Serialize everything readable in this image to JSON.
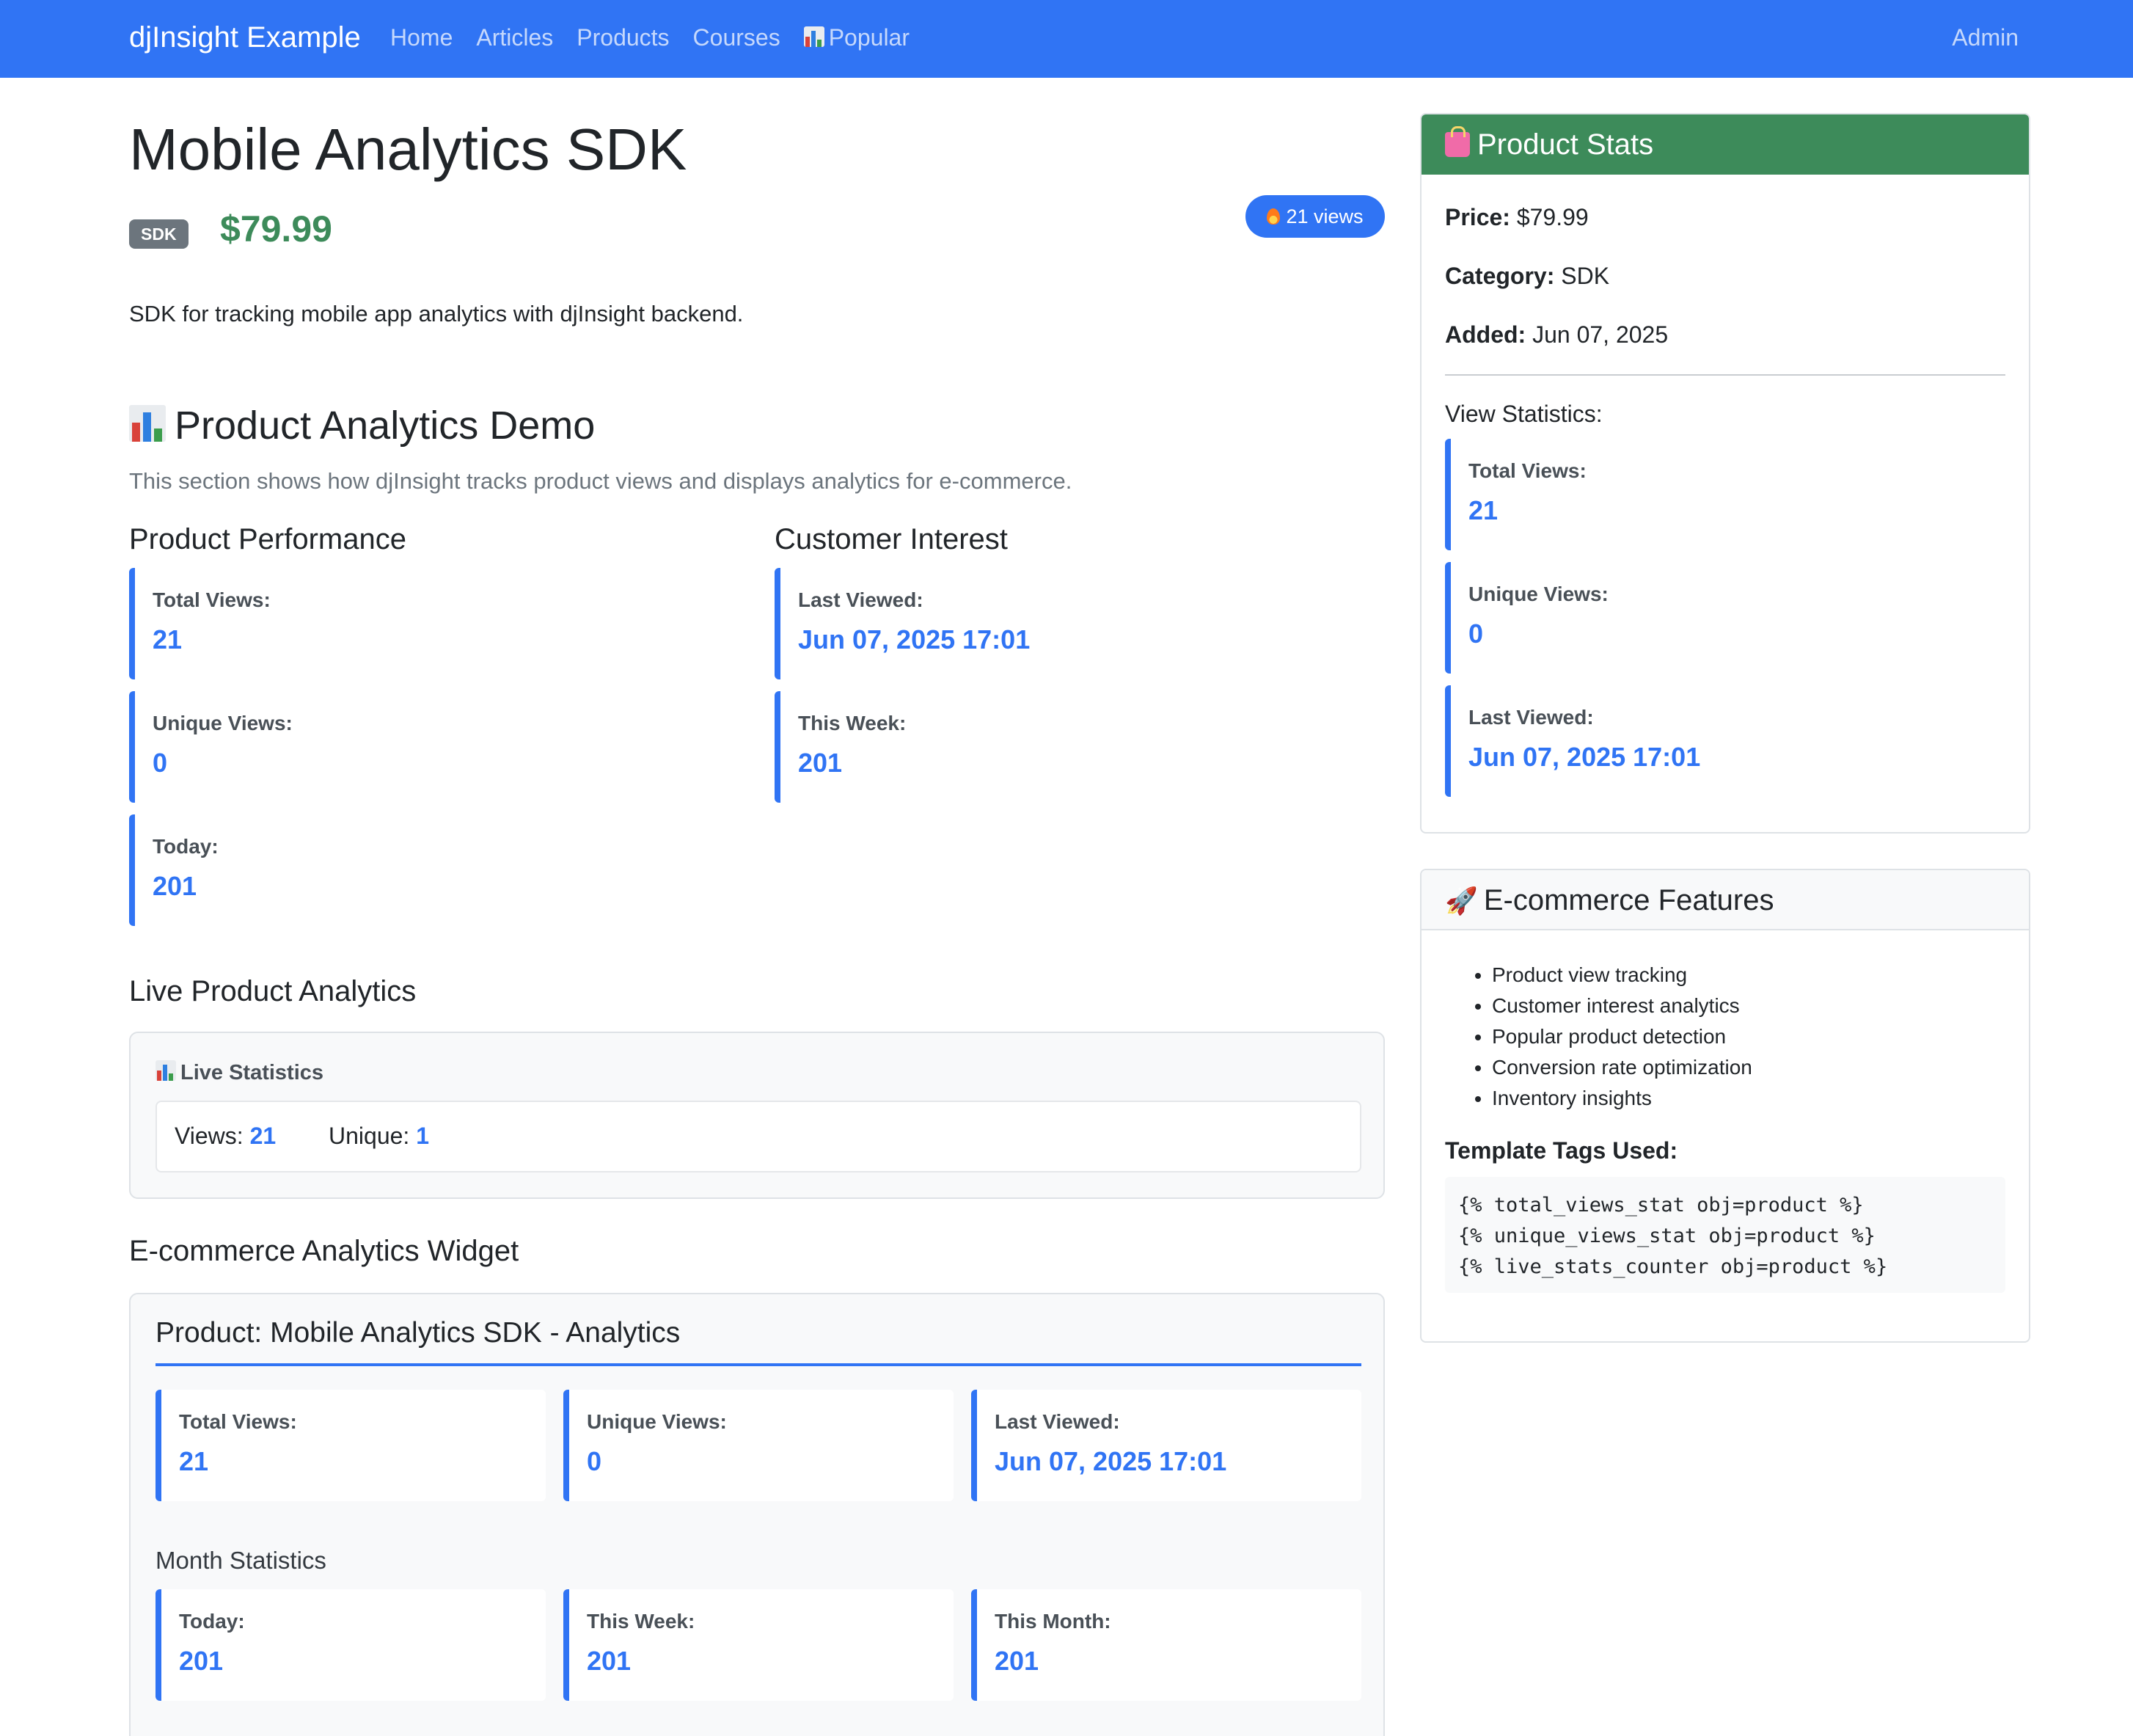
{
  "navbar": {
    "brand": "djInsight Example",
    "links": [
      "Home",
      "Articles",
      "Products",
      "Courses",
      "Popular"
    ],
    "right": "Admin"
  },
  "product": {
    "title": "Mobile Analytics SDK",
    "category_badge": "SDK",
    "price": "$79.99",
    "views_badge": "21 views",
    "description": "SDK for tracking mobile app analytics with djInsight backend."
  },
  "demo": {
    "heading": "Product Analytics Demo",
    "subtitle": "This section shows how djInsight tracks product views and displays analytics for e-commerce.",
    "performance": {
      "heading": "Product Performance",
      "stats": [
        {
          "label": "Total Views:",
          "value": "21"
        },
        {
          "label": "Unique Views:",
          "value": "0"
        },
        {
          "label": "Today:",
          "value": "201"
        }
      ]
    },
    "interest": {
      "heading": "Customer Interest",
      "stats": [
        {
          "label": "Last Viewed:",
          "value": "Jun 07, 2025 17:01"
        },
        {
          "label": "This Week:",
          "value": "201"
        }
      ]
    }
  },
  "live": {
    "heading": "Live Product Analytics",
    "box_title": "Live Statistics",
    "views_label": "Views:",
    "views_value": "21",
    "unique_label": "Unique:",
    "unique_value": "1"
  },
  "widget": {
    "heading": "E-commerce Analytics Widget",
    "title": "Product: Mobile Analytics SDK - Analytics",
    "top_stats": [
      {
        "label": "Total Views:",
        "value": "21"
      },
      {
        "label": "Unique Views:",
        "value": "0"
      },
      {
        "label": "Last Viewed:",
        "value": "Jun 07, 2025 17:01"
      }
    ],
    "month_heading": "Month Statistics",
    "month_stats": [
      {
        "label": "Today:",
        "value": "201"
      },
      {
        "label": "This Week:",
        "value": "201"
      },
      {
        "label": "This Month:",
        "value": "201"
      }
    ]
  },
  "sidebar": {
    "stats_card": {
      "title": "Product Stats",
      "price_label": "Price:",
      "price_value": "$79.99",
      "category_label": "Category:",
      "category_value": "SDK",
      "added_label": "Added:",
      "added_value": "Jun 07, 2025",
      "view_stats_heading": "View Statistics:",
      "stats": [
        {
          "label": "Total Views:",
          "value": "21"
        },
        {
          "label": "Unique Views:",
          "value": "0"
        },
        {
          "label": "Last Viewed:",
          "value": "Jun 07, 2025 17:01"
        }
      ]
    },
    "features_card": {
      "title": "E-commerce Features",
      "features": [
        "Product view tracking",
        "Customer interest analytics",
        "Popular product detection",
        "Conversion rate optimization",
        "Inventory insights"
      ],
      "tags_heading": "Template Tags Used:",
      "code_lines": [
        "{% total_views_stat obj=product %}",
        "{% unique_views_stat obj=product %}",
        "{% live_stats_counter obj=product %}"
      ]
    }
  },
  "colors": {
    "primary": "#3074f4",
    "success": "#3d8b5a",
    "secondary": "#6c757d"
  }
}
